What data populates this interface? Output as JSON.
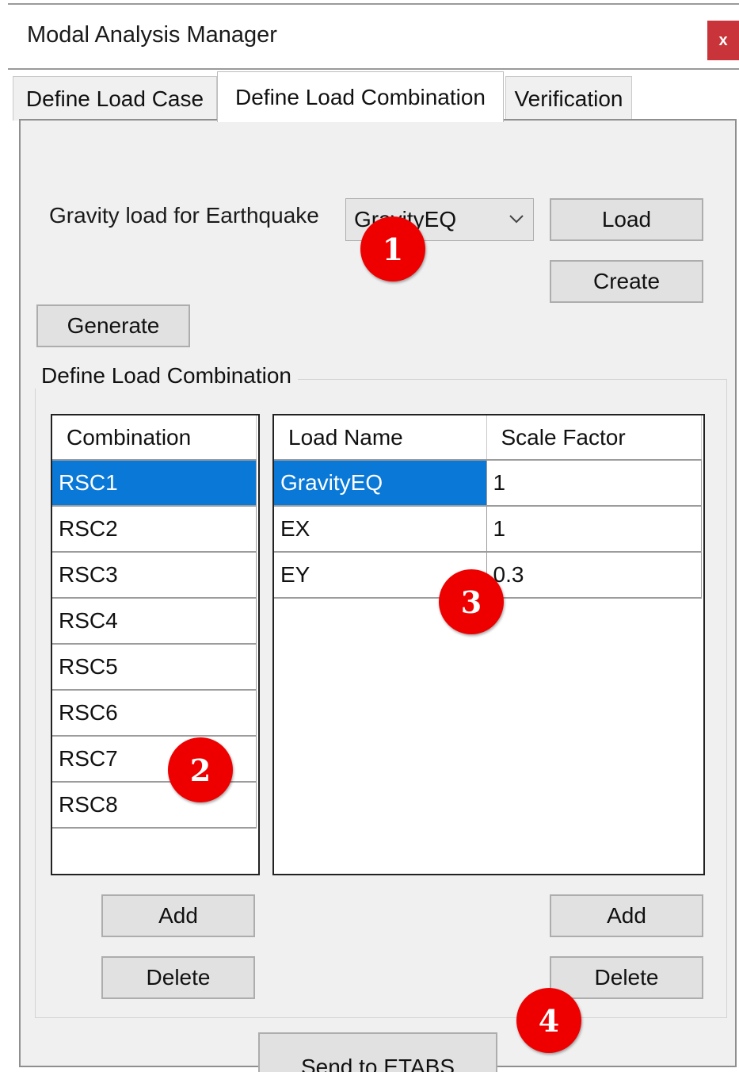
{
  "window": {
    "title": "Modal Analysis Manager",
    "close_label": "x"
  },
  "tabs": [
    {
      "label": "Define Load Case",
      "active": false
    },
    {
      "label": "Define Load Combination",
      "active": true
    },
    {
      "label": "Verification",
      "active": false
    }
  ],
  "gravity": {
    "label": "Gravity load for Earthquake",
    "selected": "GravityEQ",
    "load_button": "Load",
    "create_button": "Create"
  },
  "generate_button": "Generate",
  "group": {
    "title": "Define Load Combination",
    "combinations": {
      "header": "Combination",
      "rows": [
        "RSC1",
        "RSC2",
        "RSC3",
        "RSC4",
        "RSC5",
        "RSC6",
        "RSC7",
        "RSC8"
      ],
      "selected_index": 0,
      "add_button": "Add",
      "delete_button": "Delete"
    },
    "loads": {
      "headers": [
        "Load Name",
        "Scale Factor"
      ],
      "rows": [
        {
          "name": "GravityEQ",
          "factor": "1"
        },
        {
          "name": "EX",
          "factor": "1"
        },
        {
          "name": "EY",
          "factor": "0.3"
        }
      ],
      "add_button": "Add",
      "delete_button": "Delete"
    }
  },
  "send_button": "Send to ETABS",
  "annotations": [
    "1",
    "2",
    "3",
    "4"
  ],
  "colors": {
    "selection": "#0a78d7",
    "badge": "#ee0000",
    "close": "#c8343a"
  }
}
